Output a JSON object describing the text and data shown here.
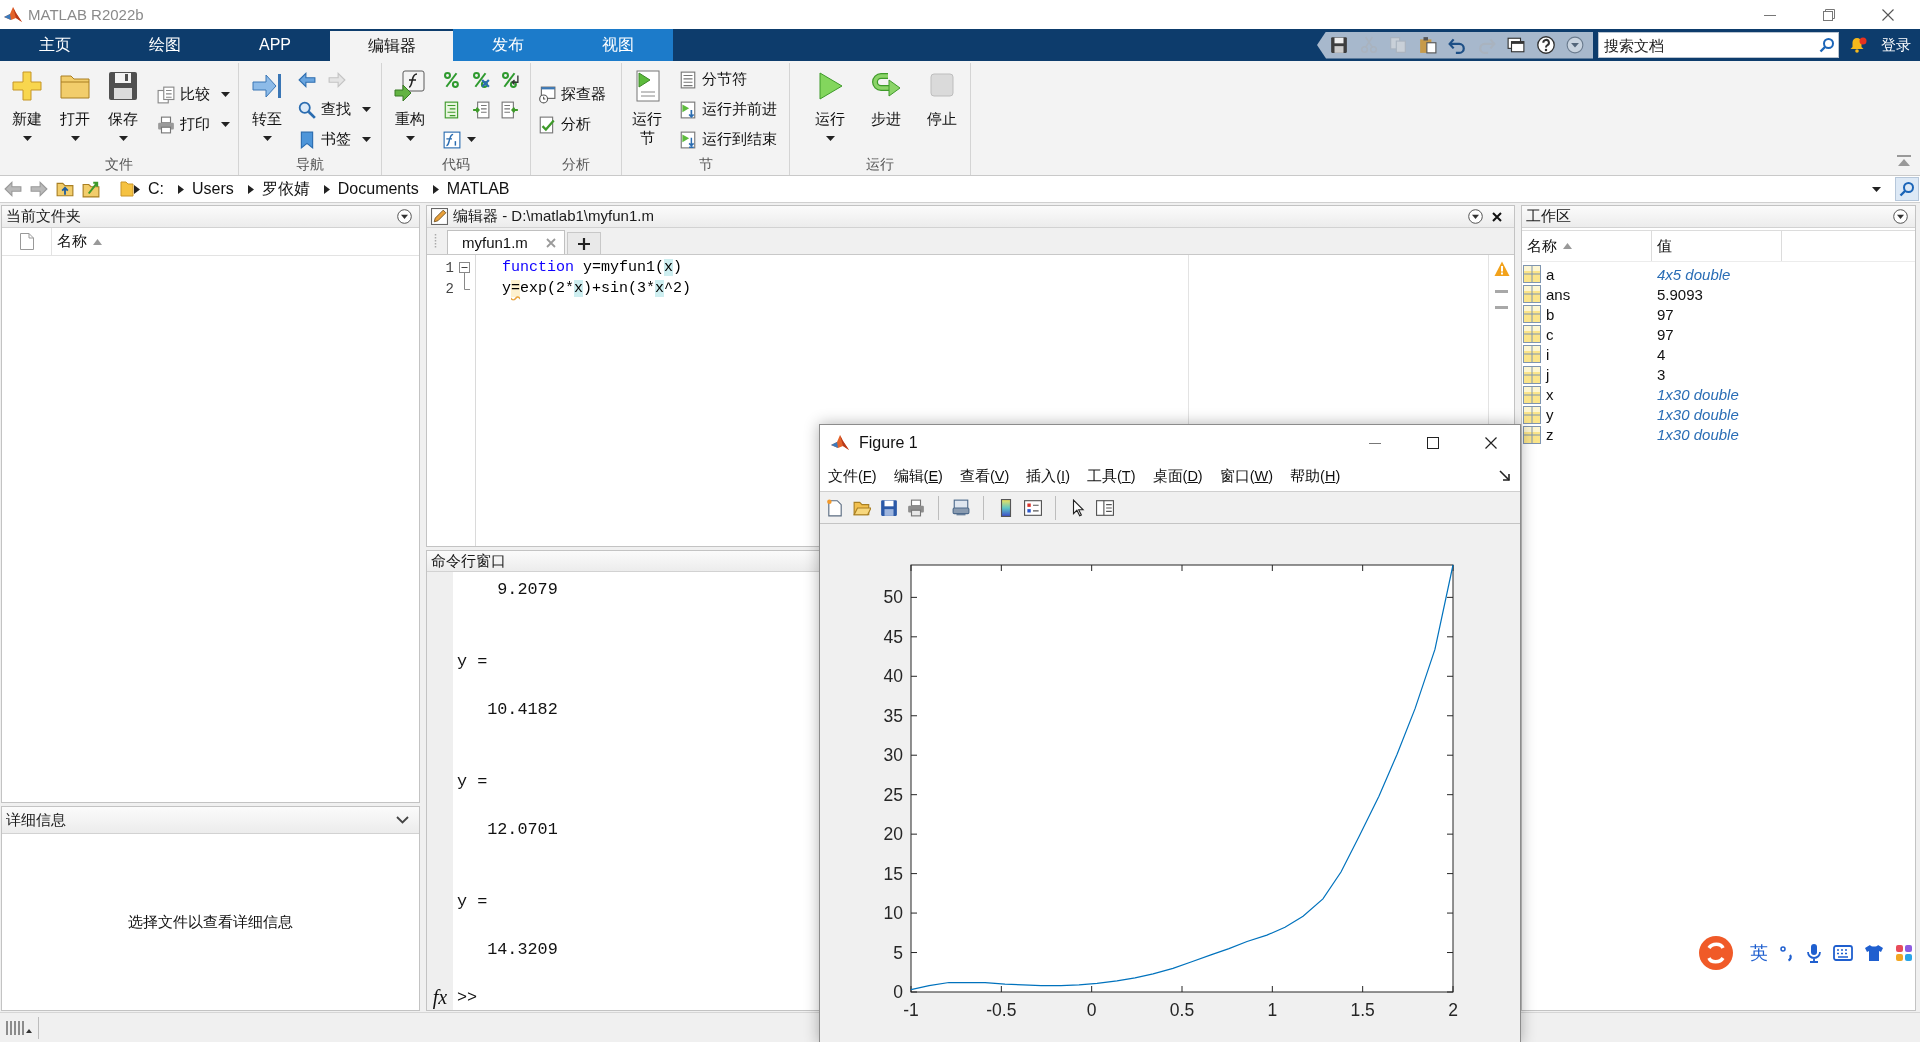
{
  "window": {
    "title": "MATLAB R2022b"
  },
  "ribbon_tabs": [
    {
      "label": "主页",
      "selected": false,
      "contextual": false
    },
    {
      "label": "绘图",
      "selected": false,
      "contextual": false
    },
    {
      "label": "APP",
      "selected": false,
      "contextual": false
    },
    {
      "label": "编辑器",
      "selected": true,
      "contextual": true
    },
    {
      "label": "发布",
      "selected": false,
      "contextual": true
    },
    {
      "label": "视图",
      "selected": false,
      "contextual": true
    }
  ],
  "search": {
    "placeholder": "搜索文档"
  },
  "account": {
    "label": "登录",
    "notification": true
  },
  "ribbon": [
    {
      "kind": "file",
      "label": "文件",
      "large": [
        {
          "label": "新建",
          "dropdown": true
        },
        {
          "label": "打开",
          "dropdown": true
        },
        {
          "label": "保存",
          "dropdown": true
        }
      ],
      "small": [
        {
          "label": "比较",
          "dropdown": true
        },
        {
          "label": "打印",
          "dropdown": true
        }
      ]
    },
    {
      "kind": "navigate",
      "label": "导航",
      "large": [
        {
          "label": "转至",
          "dropdown": true
        }
      ],
      "small": [
        {
          "label": "查找",
          "dropdown": true
        },
        {
          "label": "书签",
          "dropdown": true
        }
      ]
    },
    {
      "kind": "code",
      "label": "代码",
      "large": [
        {
          "label": "重构",
          "dropdown": true
        }
      ]
    },
    {
      "kind": "analyze",
      "label": "分析",
      "small": [
        {
          "label": "探查器",
          "dropdown": false
        },
        {
          "label": "分析",
          "dropdown": false
        }
      ]
    },
    {
      "kind": "section",
      "label": "节",
      "large": [
        {
          "label": "运行节",
          "dropdown": false
        }
      ],
      "small": [
        {
          "label": "分节符",
          "dropdown": false
        },
        {
          "label": "运行并前进",
          "dropdown": false
        },
        {
          "label": "运行到结束",
          "dropdown": false
        }
      ]
    },
    {
      "kind": "run",
      "label": "运行",
      "large": [
        {
          "label": "运行",
          "dropdown": true
        },
        {
          "label": "步进",
          "dropdown": false
        },
        {
          "label": "停止",
          "dropdown": false
        }
      ]
    }
  ],
  "address_bar": {
    "path": [
      "C:",
      "Users",
      "罗依婧",
      "Documents",
      "MATLAB"
    ]
  },
  "current_folder": {
    "title": "当前文件夹",
    "columns": [
      {
        "label": "名称",
        "sorted": true
      }
    ]
  },
  "details": {
    "title": "详细信息",
    "message": "选择文件以查看详细信息"
  },
  "editor": {
    "title": "编辑器 - D:\\matlab1\\myfun1.m",
    "warning": true,
    "messages": [
      {
        "kind": "warning"
      },
      {
        "kind": "warning"
      }
    ],
    "tabs": [
      {
        "label": "myfun1.m",
        "selected": true
      }
    ],
    "lines": [
      {
        "number": "1",
        "fold_start": true,
        "fold_end": false,
        "tokens": [
          {
            "text": "function",
            "kind": "keyword"
          },
          {
            "text": " y=myfun1(",
            "kind": "plain"
          },
          {
            "text": "x",
            "kind": "highlight"
          },
          {
            "text": ")",
            "kind": "plain"
          }
        ]
      },
      {
        "number": "2",
        "fold_start": false,
        "fold_end": true,
        "tokens": [
          {
            "text": "y",
            "kind": "plain"
          },
          {
            "text": "=",
            "kind": "warning"
          },
          {
            "text": "exp(2*",
            "kind": "plain"
          },
          {
            "text": "x",
            "kind": "highlight"
          },
          {
            "text": ")+sin(3*",
            "kind": "plain"
          },
          {
            "text": "x",
            "kind": "highlight"
          },
          {
            "text": "^2)",
            "kind": "plain"
          }
        ]
      }
    ]
  },
  "command_window": {
    "title": "命令行窗口",
    "output": [
      {
        "kind": "value",
        "text": "9.2079"
      },
      {
        "kind": "label",
        "text": "y ="
      },
      {
        "kind": "value",
        "text": "10.4182"
      },
      {
        "kind": "label",
        "text": "y ="
      },
      {
        "kind": "value",
        "text": "12.0701"
      },
      {
        "kind": "label",
        "text": "y ="
      },
      {
        "kind": "value",
        "text": "14.3209"
      }
    ],
    "function_button": "fx",
    "prompt": ">>"
  },
  "workspace": {
    "title": "工作区",
    "columns": [
      {
        "label": "名称",
        "sorted": true
      },
      {
        "label": "值",
        "sorted": false
      }
    ],
    "variables": [
      {
        "name": "a",
        "value": "4x5 double",
        "kind": "array"
      },
      {
        "name": "ans",
        "value": "5.9093",
        "kind": "scalar"
      },
      {
        "name": "b",
        "value": "97",
        "kind": "scalar"
      },
      {
        "name": "c",
        "value": "97",
        "kind": "scalar"
      },
      {
        "name": "i",
        "value": "4",
        "kind": "scalar"
      },
      {
        "name": "j",
        "value": "3",
        "kind": "scalar"
      },
      {
        "name": "x",
        "value": "1x30 double",
        "kind": "array"
      },
      {
        "name": "y",
        "value": "1x30 double",
        "kind": "array"
      },
      {
        "name": "z",
        "value": "1x30 double",
        "kind": "array"
      }
    ]
  },
  "figure": {
    "title": "Figure 1",
    "menu": [
      "文件(F)",
      "编辑(E)",
      "查看(V)",
      "插入(I)",
      "工具(T)",
      "桌面(D)",
      "窗口(W)",
      "帮助(H)"
    ],
    "chart_data": [
      {
        "type": "line",
        "x": [
          -1,
          -0.9,
          -0.79,
          -0.69,
          -0.59,
          -0.48,
          -0.38,
          -0.28,
          -0.17,
          -0.07,
          0.03,
          0.14,
          0.24,
          0.34,
          0.45,
          0.55,
          0.66,
          0.76,
          0.86,
          0.97,
          1.07,
          1.17,
          1.28,
          1.38,
          1.48,
          1.59,
          1.69,
          1.79,
          1.9,
          2
        ],
        "values": [
          0.3,
          0.8,
          1.2,
          1.2,
          1.2,
          1,
          0.9,
          0.8,
          0.8,
          0.9,
          1.1,
          1.4,
          1.8,
          2.3,
          3,
          3.8,
          4.7,
          5.5,
          6.4,
          7.2,
          8.2,
          9.6,
          11.8,
          15.2,
          19.7,
          24.8,
          30.1,
          35.9,
          43.4,
          54.1
        ],
        "color": "#0072bd",
        "xlim": [
          -1,
          2
        ],
        "ylim": [
          0,
          54.1
        ],
        "xticks": [
          -1,
          -0.5,
          0,
          0.5,
          1,
          1.5,
          2
        ],
        "yticks": [
          0,
          5,
          10,
          15,
          20,
          25,
          30,
          35,
          40,
          45,
          50
        ]
      }
    ]
  },
  "ime_toolbar": {
    "mode": "英"
  }
}
